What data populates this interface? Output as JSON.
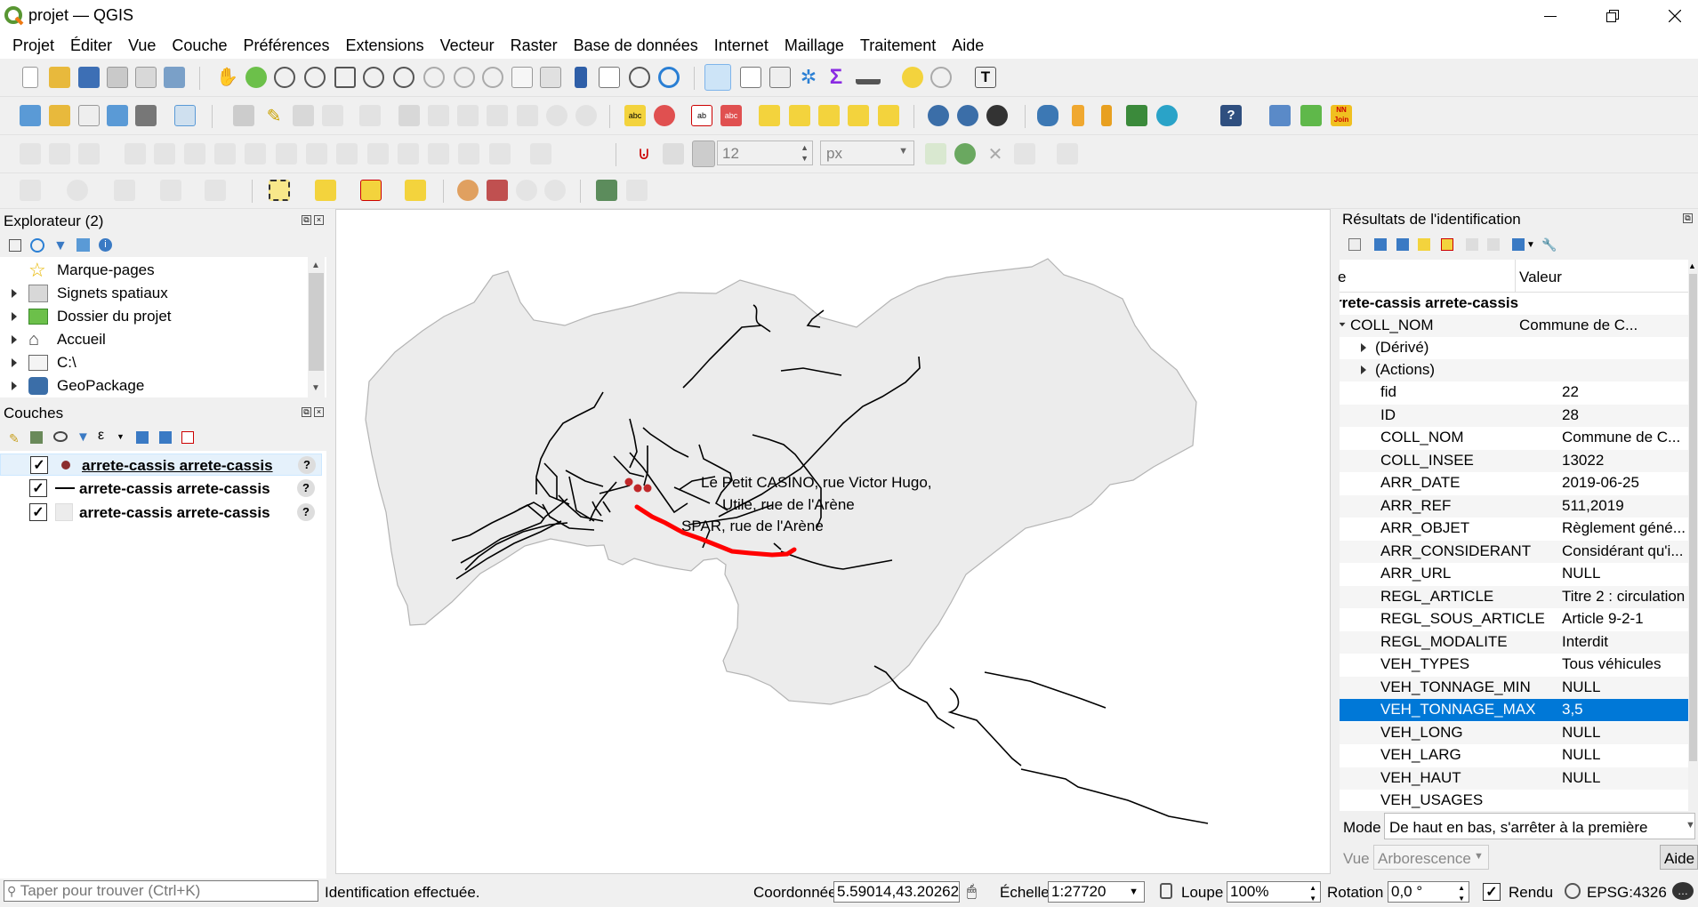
{
  "window": {
    "title": "projet — QGIS"
  },
  "menu": [
    "Projet",
    "Éditer",
    "Vue",
    "Couche",
    "Préférences",
    "Extensions",
    "Vecteur",
    "Raster",
    "Base de données",
    "Internet",
    "Maillage",
    "Traitement",
    "Aide"
  ],
  "snapping": {
    "tolerance": "12",
    "unit": "px"
  },
  "browser": {
    "title": "Explorateur (2)",
    "items": [
      {
        "label": "Marque-pages",
        "icon": "star-icon",
        "expandable": false
      },
      {
        "label": "Signets spatiaux",
        "icon": "spatial-bookmark-icon",
        "expandable": true
      },
      {
        "label": "Dossier du projet",
        "icon": "project-folder-icon",
        "expandable": true
      },
      {
        "label": "Accueil",
        "icon": "home-icon",
        "expandable": true
      },
      {
        "label": "C:\\",
        "icon": "drive-icon",
        "expandable": true
      },
      {
        "label": "GeoPackage",
        "icon": "geopackage-icon",
        "expandable": true
      }
    ]
  },
  "layers": {
    "title": "Couches",
    "items": [
      {
        "label": "arrete-cassis arrete-cassis",
        "symbol": "point",
        "checked": true,
        "selected": true
      },
      {
        "label": "arrete-cassis arrete-cassis",
        "symbol": "line",
        "checked": true,
        "selected": false
      },
      {
        "label": "arrete-cassis arrete-cassis",
        "symbol": "polygon",
        "checked": true,
        "selected": false
      }
    ]
  },
  "map": {
    "labels": [
      "Le Petit CASINO, rue Victor Hugo,",
      "Utile, rue de l'Arène",
      "SPAR, rue de l'Arène"
    ],
    "colors": {
      "polygon_fill": "#ececec",
      "polygon_stroke": "#b4b4b4",
      "roads": "#000000",
      "highlight": "#ff0000",
      "points": "#c0282a"
    }
  },
  "identify": {
    "title": "Résultats de l'identification",
    "col_feature": "e",
    "col_value": "Valeur",
    "layer_header": "rrete-cassis arrete-cassis",
    "root_field": "COLL_NOM",
    "root_value": "Commune de C...",
    "derived": "(Dérivé)",
    "actions": "(Actions)",
    "rows": [
      {
        "field": "fid",
        "value": "22"
      },
      {
        "field": "ID",
        "value": "28"
      },
      {
        "field": "COLL_NOM",
        "value": "Commune de C..."
      },
      {
        "field": "COLL_INSEE",
        "value": "13022"
      },
      {
        "field": "ARR_DATE",
        "value": "2019-06-25"
      },
      {
        "field": "ARR_REF",
        "value": "511,2019"
      },
      {
        "field": "ARR_OBJET",
        "value": "Règlement géné..."
      },
      {
        "field": "ARR_CONSIDERANT",
        "value": "Considérant qu'i..."
      },
      {
        "field": "ARR_URL",
        "value": "NULL"
      },
      {
        "field": "REGL_ARTICLE",
        "value": "Titre 2 : circulation"
      },
      {
        "field": "REGL_SOUS_ARTICLE",
        "value": "Article 9-2-1"
      },
      {
        "field": "REGL_MODALITE",
        "value": "Interdit"
      },
      {
        "field": "VEH_TYPES",
        "value": "Tous véhicules"
      },
      {
        "field": "VEH_TONNAGE_MIN",
        "value": "NULL"
      },
      {
        "field": "VEH_TONNAGE_MAX",
        "value": "3,5"
      },
      {
        "field": "VEH_LONG",
        "value": "NULL"
      },
      {
        "field": "VEH_LARG",
        "value": "NULL"
      },
      {
        "field": "VEH_HAUT",
        "value": "NULL"
      },
      {
        "field": "VEH_USAGES",
        "value": ""
      }
    ],
    "selected_index": 14,
    "mode_label": "Mode",
    "mode_value": "De haut en bas, s'arrêter à la première",
    "view_label": "Vue",
    "view_value": "Arborescence",
    "help_label": "Aide"
  },
  "status": {
    "search_placeholder": "Taper pour trouver (Ctrl+K)",
    "message": "Identification effectuée.",
    "coord_label": "Coordonnée",
    "coord_value": "5.59014,43.20262",
    "scale_label": "Échelle",
    "scale_value": "1:27720",
    "magnifier_label": "Loupe",
    "magnifier_value": "100%",
    "rotation_label": "Rotation",
    "rotation_value": "0,0 °",
    "render_label": "Rendu",
    "crs": "EPSG:4326"
  }
}
